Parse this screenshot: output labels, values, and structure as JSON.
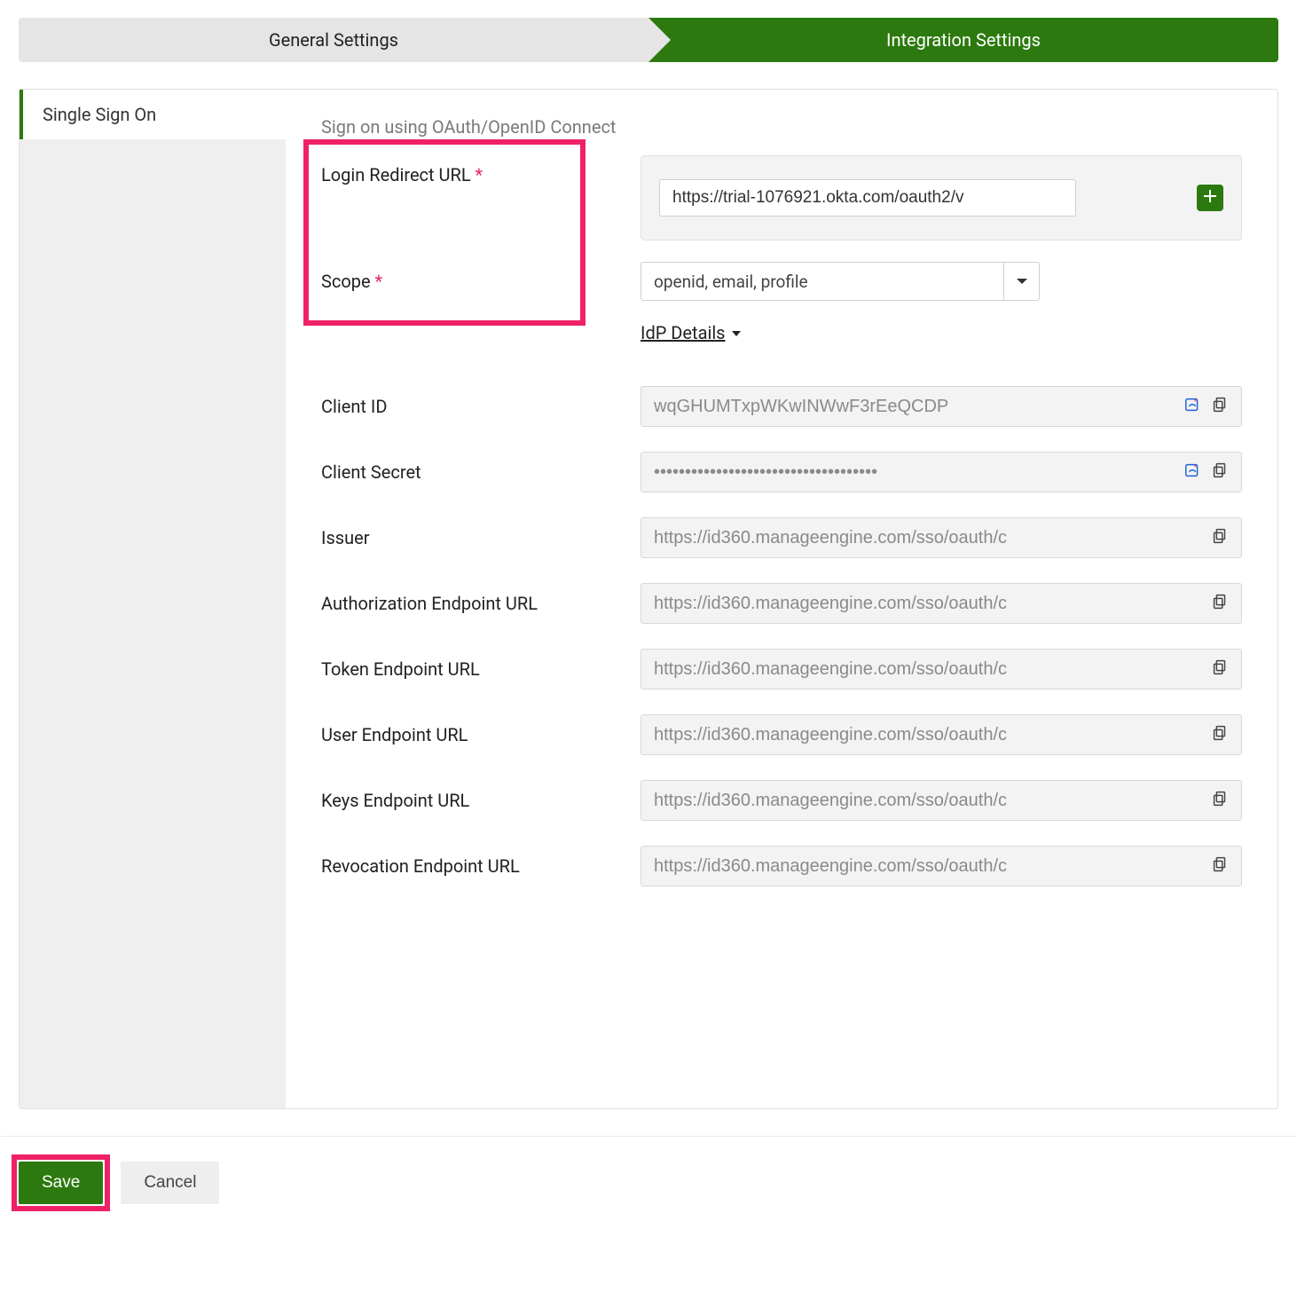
{
  "steps": {
    "general": "General Settings",
    "integration": "Integration Settings"
  },
  "sidebar": {
    "single_sign_on": "Single Sign On"
  },
  "desc": "Sign on using OAuth/OpenID Connect",
  "labels": {
    "login_redirect": "Login Redirect URL ",
    "scope": "Scope ",
    "client_id": "Client ID",
    "client_secret": "Client Secret",
    "issuer": "Issuer",
    "auth_endpoint": "Authorization Endpoint URL",
    "token_endpoint": "Token Endpoint URL",
    "user_endpoint": "User Endpoint URL",
    "keys_endpoint": "Keys Endpoint URL",
    "revocation_endpoint": "Revocation Endpoint URL"
  },
  "fields": {
    "login_redirect": "https://trial-1076921.okta.com/oauth2/v",
    "scope": "openid, email, profile",
    "client_id": "wqGHUMTxpWKwINWwF3rEeQCDP",
    "client_secret": "••••••••••••••••••••••••••••••••••••",
    "issuer": "https://id360.manageengine.com/sso/oauth/c",
    "auth_endpoint": "https://id360.manageengine.com/sso/oauth/c",
    "token_endpoint": "https://id360.manageengine.com/sso/oauth/c",
    "user_endpoint": "https://id360.manageengine.com/sso/oauth/c",
    "keys_endpoint": "https://id360.manageengine.com/sso/oauth/c",
    "revocation_endpoint": "https://id360.manageengine.com/sso/oauth/c"
  },
  "idp_toggle": "IdP Details",
  "buttons": {
    "save": "Save",
    "cancel": "Cancel"
  },
  "req": "*"
}
